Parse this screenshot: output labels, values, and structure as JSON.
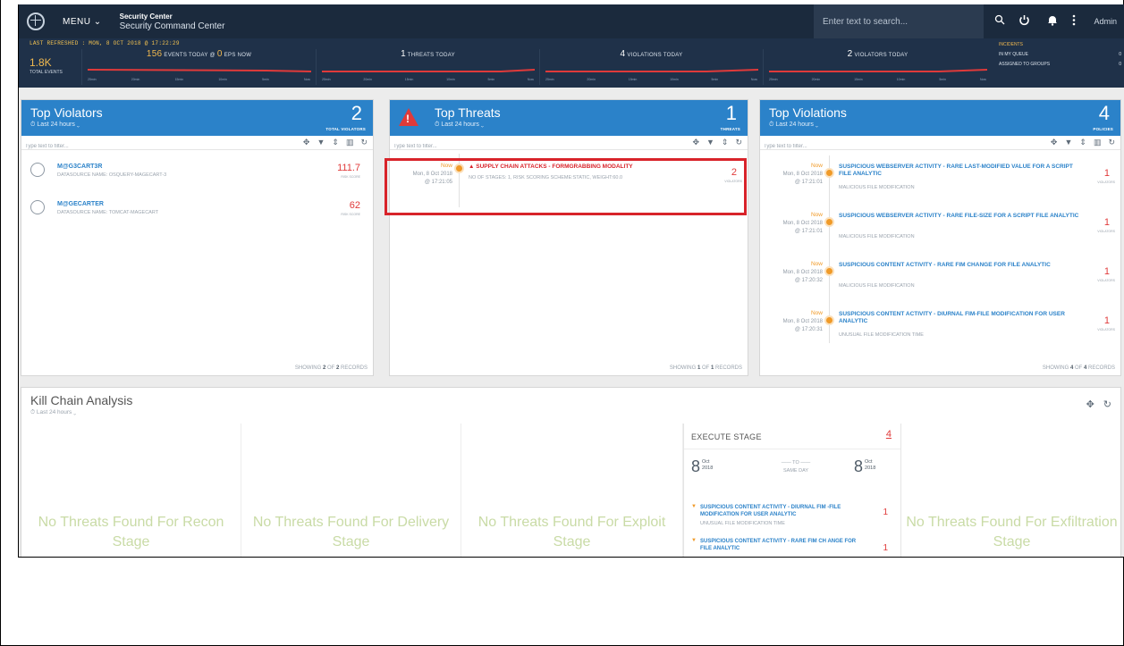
{
  "topbar": {
    "menu": "MENU ⌄",
    "title_small": "Security Center",
    "title_main": "Security Command Center",
    "search_placeholder": "Enter text to search...",
    "user": "Admin"
  },
  "stats": {
    "last_refreshed": "LAST REFRESHED : MON, 8 OCT 2018 @ 17:22:29",
    "total_events_value": "1.8K",
    "total_events_label": "TOTAL EVENTS",
    "events_today_value": "156",
    "events_today_label": "EVENTS TODAY @",
    "eps_value": "0",
    "eps_label": "EPS NOW",
    "threats_today_value": "1",
    "threats_today_label": "THREATS TODAY",
    "violations_today_value": "4",
    "violations_today_label": "VIOLATIONS TODAY",
    "violators_today_value": "2",
    "violators_today_label": "VIOLATORS TODAY",
    "tick_labels": [
      "25min",
      "20min",
      "15min",
      "10min",
      "5min",
      "Now"
    ],
    "incidents": {
      "title": "INCIDENTS",
      "my_queue_label": "IN MY QUEUE",
      "my_queue_value": "0",
      "groups_label": "ASSIGNED TO GROUPS",
      "groups_value": "0"
    }
  },
  "top_violators": {
    "title": "Top Violators",
    "range": "⏱ Last 24 hours ⌄",
    "count": "2",
    "count_label": "TOTAL VIOLATORS",
    "filter_placeholder": "Type text to filter...",
    "items": [
      {
        "name": "M@G3CART3R",
        "datasource": "DATASOURCE NAME: OSQUERY-MAGECART-3",
        "score": "111.7",
        "score_label": "RISK SCORE"
      },
      {
        "name": "M@GECARTER",
        "datasource": "DATASOURCE NAME: TOMCAT-MAGECART",
        "score": "62",
        "score_label": "RISK SCORE"
      }
    ],
    "footer_prefix": "SHOWING",
    "footer_shown": "2",
    "footer_of": "OF",
    "footer_total": "2",
    "footer_suffix": "RECORDS"
  },
  "top_threats": {
    "title": "Top Threats",
    "range": "⏱ Last 24 hours ⌄",
    "count": "1",
    "count_label": "THREATS",
    "filter_placeholder": "Type text to filter...",
    "items": [
      {
        "now": "Now",
        "date": "Mon, 8 Oct 2018",
        "time": "@ 17:21:05",
        "title": "▲ SUPPLY CHAIN ATTACKS - FORMGRABBING MODALITY",
        "sub": "NO OF STAGES: 1, RISK SCORING SCHEME:STATIC, WEIGHT:60.0",
        "count": "2",
        "count_label": "VIOLATORS"
      }
    ],
    "footer_prefix": "SHOWING",
    "footer_shown": "1",
    "footer_of": "OF",
    "footer_total": "1",
    "footer_suffix": "RECORDS"
  },
  "top_violations": {
    "title": "Top Violations",
    "range": "⏱ Last 24 hours ⌄",
    "count": "4",
    "count_label": "POLICIES",
    "filter_placeholder": "Type text to filter...",
    "items": [
      {
        "now": "Now",
        "date": "Mon, 8 Oct 2018",
        "time": "@ 17:21:01",
        "title": "SUSPICIOUS WEBSERVER ACTIVITY - RARE LAST-MODIFIED VALUE FOR A SCRIPT FILE ANALYTIC",
        "sub": "MALICIOUS FILE MODIFICATION",
        "count": "1",
        "count_label": "VIOLATORS"
      },
      {
        "now": "Now",
        "date": "Mon, 8 Oct 2018",
        "time": "@ 17:21:01",
        "title": "SUSPICIOUS WEBSERVER ACTIVITY - RARE FILE-SIZE FOR A SCRIPT FILE ANALYTIC",
        "sub": "MALICIOUS FILE MODIFICATION",
        "count": "1",
        "count_label": "VIOLATORS"
      },
      {
        "now": "Now",
        "date": "Mon, 8 Oct 2018",
        "time": "@ 17:20:32",
        "title": "SUSPICIOUS CONTENT ACTIVITY - RARE FIM CHANGE FOR FILE ANALYTIC",
        "sub": "MALICIOUS FILE MODIFICATION",
        "count": "1",
        "count_label": "VIOLATORS"
      },
      {
        "now": "Now",
        "date": "Mon, 8 Oct 2018",
        "time": "@ 17:20:31",
        "title": "SUSPICIOUS CONTENT ACTIVITY - DIURNAL FIM-FILE MODIFICATION FOR USER ANALYTIC",
        "sub": "UNUSUAL FILE MODIFICATION TIME",
        "count": "1",
        "count_label": "VIOLATORS"
      }
    ],
    "footer_prefix": "SHOWING",
    "footer_shown": "4",
    "footer_of": "OF",
    "footer_total": "4",
    "footer_suffix": "RECORDS"
  },
  "kill_chain": {
    "title": "Kill Chain Analysis",
    "range": "⏱ Last 24 hours ⌄",
    "stages": [
      {
        "text": "No Threats Found For Recon Stage"
      },
      {
        "text": "No Threats Found For Delivery Stage"
      },
      {
        "text": "No Threats Found For Exploit Stage"
      },
      {
        "text": "No Threats Found For Exfiltration Stage"
      }
    ],
    "execute": {
      "title": "EXECUTE STAGE",
      "count": "4",
      "from_day": "8",
      "from_month": "Oct",
      "from_year": "2018",
      "to_label": "—— TO ——",
      "same_day": "SAME DAY",
      "to_day": "8",
      "to_month": "Oct",
      "to_year": "2018",
      "items": [
        {
          "title": "SUSPICIOUS CONTENT ACTIVITY - DIURNAL FIM -FILE MODIFICATION FOR USER ANALYTIC",
          "sub": "UNUSUAL FILE MODIFICATION TIME",
          "count": "1"
        },
        {
          "title": "SUSPICIOUS CONTENT ACTIVITY - RARE FIM CH ANGE FOR FILE ANALYTIC",
          "sub": "",
          "count": "1"
        }
      ]
    }
  },
  "colors": {
    "topbar": "#1b2a3d",
    "widget_header": "#2b82c9",
    "alert_red": "#e03a3a",
    "accent_orange": "#f09a28",
    "highlight_box": "#d8232a"
  }
}
